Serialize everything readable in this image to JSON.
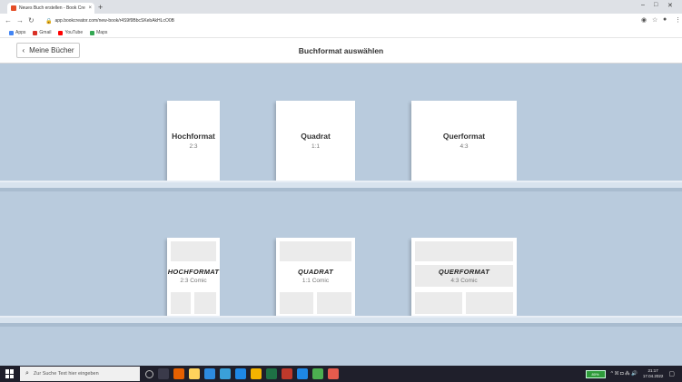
{
  "browser": {
    "tab_title": "Neues Buch erstellen - Book Cre",
    "tab_close": "×",
    "new_tab": "+",
    "url": "app.bookcreator.com/new-book/r4S9f9BbcSKebAkHLcO0B",
    "bookmarks": [
      {
        "label": "Apps",
        "color": "#4285f4"
      },
      {
        "label": "Gmail",
        "color": "#d93025"
      },
      {
        "label": "YouTube",
        "color": "#ff0000"
      },
      {
        "label": "Maps",
        "color": "#34a853"
      }
    ],
    "window_controls": [
      "–",
      "□",
      "✕"
    ]
  },
  "header": {
    "back_label": "Meine Bücher",
    "title": "Buchformat auswählen"
  },
  "formats": [
    {
      "name": "Hochformat",
      "ratio": "2:3"
    },
    {
      "name": "Quadrat",
      "ratio": "1:1"
    },
    {
      "name": "Querformat",
      "ratio": "4:3"
    }
  ],
  "comics": [
    {
      "name": "HOCHFORMAT",
      "ratio": "2:3 Comic"
    },
    {
      "name": "QUADRAT",
      "ratio": "1:1 Comic"
    },
    {
      "name": "QUERFORMAT",
      "ratio": "4:3 Comic"
    }
  ],
  "taskbar": {
    "search_placeholder": "Zur Suche Text hier eingeben",
    "battery": "80%",
    "time": "21:17",
    "date": "17.04.2022",
    "tray": "^ ☒ ◘ ⁂ 🔊"
  }
}
